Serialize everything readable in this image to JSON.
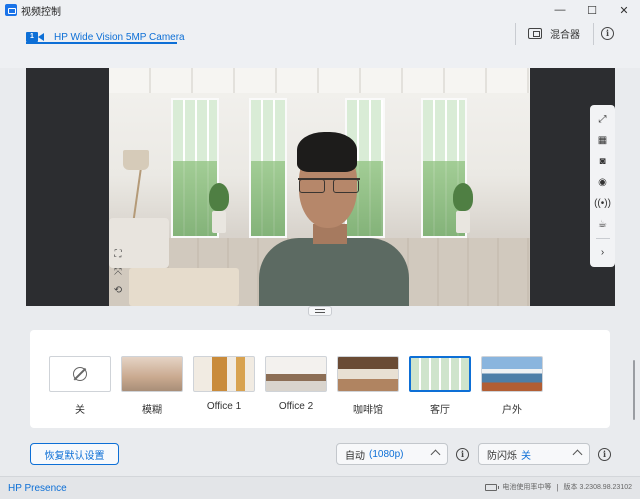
{
  "window": {
    "title": "视频控制",
    "controls": [
      "—",
      "☐",
      "✕"
    ]
  },
  "header": {
    "camera_index": "1",
    "camera_name": "HP Wide Vision 5MP Camera",
    "mixer_label": "混合器",
    "info_glyph": "i"
  },
  "preview": {
    "left_tools": [
      "crop-icon",
      "fit-icon",
      "rotate-icon"
    ],
    "right_tools": [
      "expand-icon",
      "hdr-icon",
      "camera-snapshot-icon",
      "record-icon",
      "broadcast-icon",
      "coffee-icon",
      "chevron-right-icon"
    ]
  },
  "backgrounds": {
    "items": [
      {
        "label": "关"
      },
      {
        "label": "模糊"
      },
      {
        "label": "Office 1"
      },
      {
        "label": "Office 2"
      },
      {
        "label": "咖啡馆"
      },
      {
        "label": "客厅"
      },
      {
        "label": "户外"
      }
    ],
    "selected": "客厅"
  },
  "controls": {
    "reset_label": "恢复默认设置",
    "resolution_label": "自动",
    "resolution_value": "(1080p)",
    "flicker_label": "防闪烁",
    "flicker_value": "关"
  },
  "footer": {
    "brand": "HP Presence",
    "battery_text": "电池使用率中等",
    "version": "版本 3.2308.98.23102"
  },
  "colors": {
    "accent": "#0d6fd6",
    "preview_bg": "#2c2d30"
  }
}
